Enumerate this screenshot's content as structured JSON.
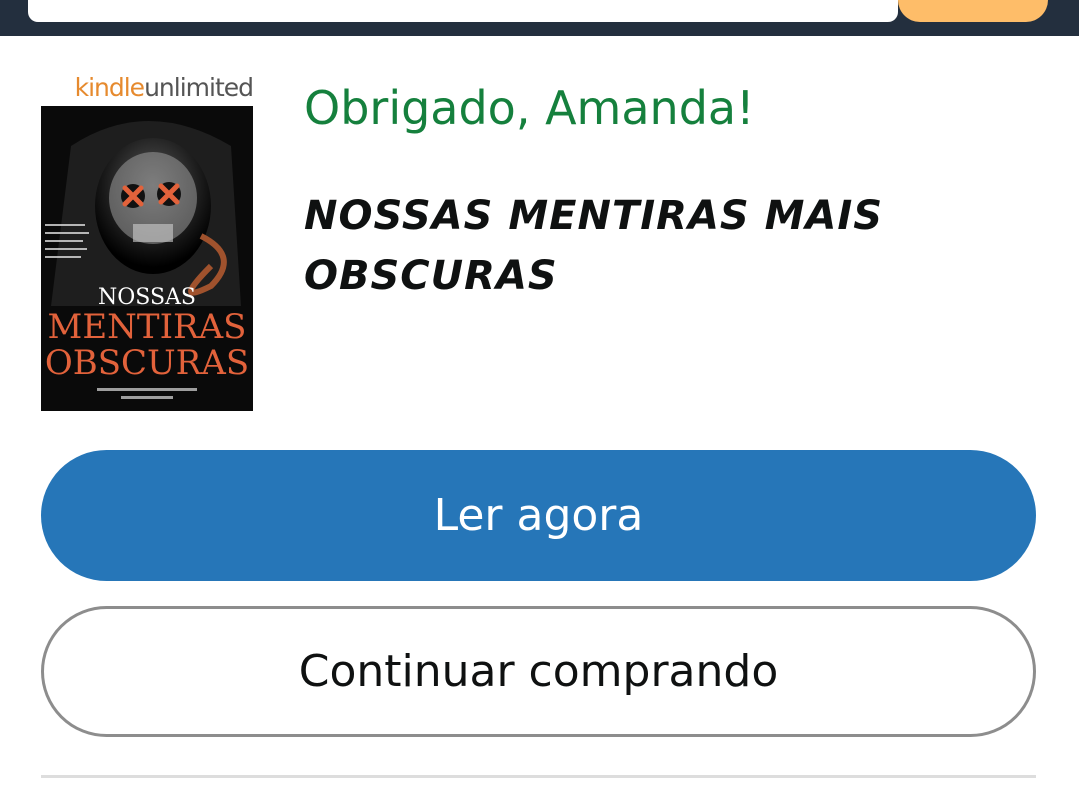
{
  "header": {
    "colors": {
      "bar": "#232f3e",
      "search_button": "#febd69"
    }
  },
  "book": {
    "badge_kindle": "kindle",
    "badge_unlimited": "unlimited",
    "cover_icon": "book-cover-image",
    "title": "NOSSAS MENTIRAS MAIS OBSCURAS"
  },
  "confirmation": {
    "greeting": "Obrigado, Amanda!",
    "greeting_color": "#15803d"
  },
  "actions": {
    "read_now_label": "Ler agora",
    "read_now_color": "#2676b8",
    "continue_shopping_label": "Continuar comprando"
  }
}
